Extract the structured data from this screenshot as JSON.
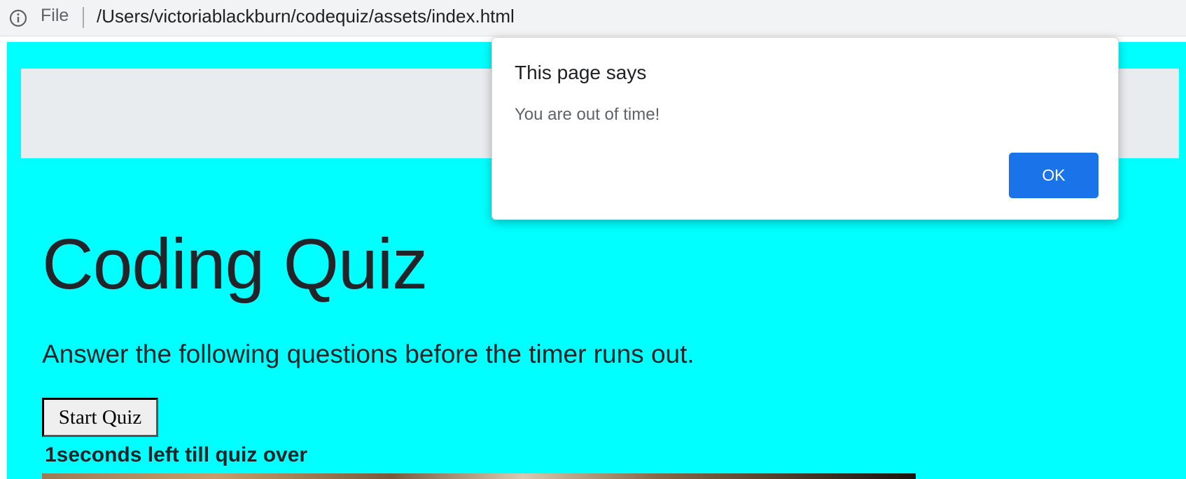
{
  "browser": {
    "scheme_label": "File",
    "url": "/Users/victoriablackburn/codequiz/assets/index.html",
    "info_icon": "info-icon"
  },
  "page": {
    "title": "Coding Quiz",
    "subtitle": "Answer the following questions before the timer runs out.",
    "start_button_label": "Start Quiz",
    "timer_text": "1seconds left till quiz over",
    "colors": {
      "background": "#00ffff",
      "jumbotron": "#e9ecef",
      "text": "#212529"
    }
  },
  "alert": {
    "title": "This page says",
    "message": "You are out of time!",
    "ok_label": "OK",
    "ok_color": "#1a73e8"
  }
}
